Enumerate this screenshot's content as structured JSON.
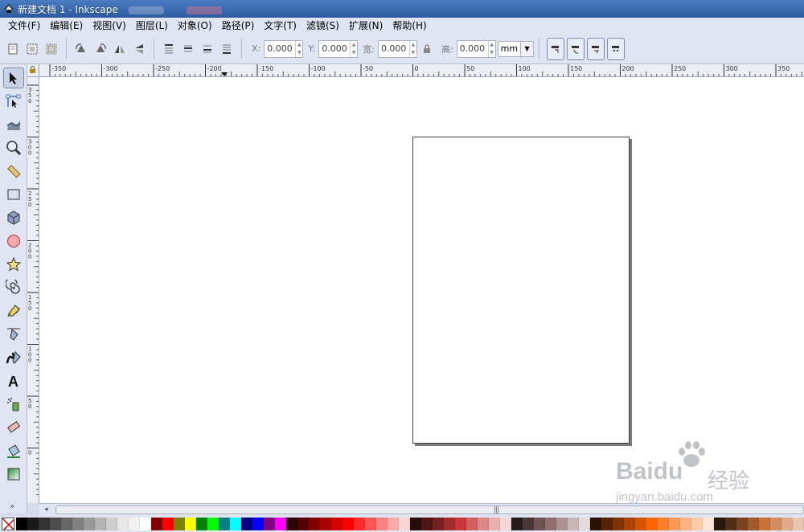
{
  "window": {
    "title": "新建文档 1 - Inkscape"
  },
  "menu": {
    "items": [
      "文件(F)",
      "编辑(E)",
      "视图(V)",
      "图层(L)",
      "对象(O)",
      "路径(P)",
      "文字(T)",
      "滤镜(S)",
      "扩展(N)",
      "帮助(H)"
    ]
  },
  "toolbar": {
    "x_label": "X:",
    "x_value": "0.000",
    "y_label": "Y:",
    "y_value": "0.000",
    "w_label": "宽:",
    "w_value": "0.000",
    "h_label": "高:",
    "h_value": "0.000",
    "unit": "mm"
  },
  "ruler": {
    "h_labels": [
      "-350",
      "-300",
      "-250",
      "-200",
      "-150",
      "-100",
      "-50",
      "0",
      "50",
      "100",
      "150",
      "200",
      "250",
      "300",
      "350"
    ],
    "v_labels": [
      "350",
      "300",
      "250",
      "200",
      "150",
      "100",
      "50",
      "0"
    ]
  },
  "tools": [
    "selector-tool",
    "node-tool",
    "tweak-tool",
    "zoom-tool",
    "measure-tool",
    "rectangle-tool",
    "3d-box-tool",
    "ellipse-tool",
    "star-tool",
    "spiral-tool",
    "pencil-tool",
    "pen-tool",
    "calligraphy-tool",
    "text-tool",
    "spray-tool",
    "eraser-tool",
    "paint-bucket-tool",
    "gradient-tool"
  ],
  "palette": {
    "colors": [
      "#000000",
      "#1a1a1a",
      "#333333",
      "#4d4d4d",
      "#666666",
      "#808080",
      "#999999",
      "#b3b3b3",
      "#cccccc",
      "#e6e6e6",
      "#f2f2f2",
      "#ffffff",
      "#800000",
      "#ff0000",
      "#808000",
      "#ffff00",
      "#008000",
      "#00ff00",
      "#008080",
      "#00ffff",
      "#000080",
      "#0000ff",
      "#800080",
      "#ff00ff",
      "#2b0000",
      "#550000",
      "#800000",
      "#aa0000",
      "#d40000",
      "#ff0000",
      "#ff2a2a",
      "#ff5555",
      "#ff8080",
      "#ffaaaa",
      "#ffd5d5",
      "#280b0b",
      "#501616",
      "#782121",
      "#a02c2c",
      "#c83737",
      "#d35f5f",
      "#de8787",
      "#e9afaf",
      "#f4d7d7",
      "#241c1c",
      "#483737",
      "#6c5353",
      "#916f6f",
      "#ac9393",
      "#c8b7b7",
      "#e3dbdb",
      "#2b1100",
      "#552200",
      "#803300",
      "#aa4400",
      "#d45500",
      "#ff6600",
      "#ff7f2a",
      "#ff9955",
      "#ffb380",
      "#ffccaa",
      "#ffe6d5",
      "#28170b",
      "#502d16",
      "#784421",
      "#a05a2c",
      "#c87137",
      "#d38d5f",
      "#deaa87",
      "#e9c6af"
    ]
  },
  "watermark": {
    "brand": "Baidu",
    "brand_cn": "经验",
    "url": "jingyan.baidu.com"
  }
}
